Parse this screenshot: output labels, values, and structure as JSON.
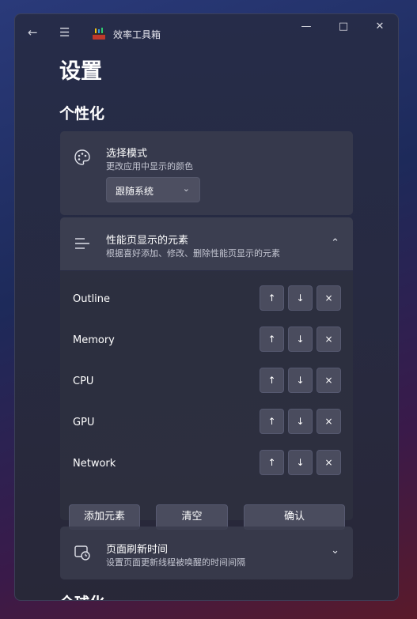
{
  "window": {
    "app_title": "效率工具箱",
    "back_icon": "arrow-left-icon",
    "menu_icon": "hamburger-icon"
  },
  "page": {
    "title": "设置",
    "section_personalization": "个性化",
    "section_globalization": "全球化"
  },
  "mode_card": {
    "title": "选择模式",
    "desc": "更改应用中显示的颜色",
    "dropdown_value": "跟随系统"
  },
  "perf_card": {
    "title": "性能页显示的元素",
    "desc": "根据喜好添加、修改、删除性能页显示的元素",
    "items": [
      {
        "label": "Outline"
      },
      {
        "label": "Memory"
      },
      {
        "label": "CPU"
      },
      {
        "label": "GPU"
      },
      {
        "label": "Network"
      }
    ],
    "add_label": "添加元素",
    "clear_label": "清空",
    "confirm_label": "确认"
  },
  "refresh_card": {
    "title": "页面刷新时间",
    "desc": "设置页面更新线程被唤醒的时间间隔"
  },
  "colors": {
    "accent": "#3a1a4a"
  }
}
